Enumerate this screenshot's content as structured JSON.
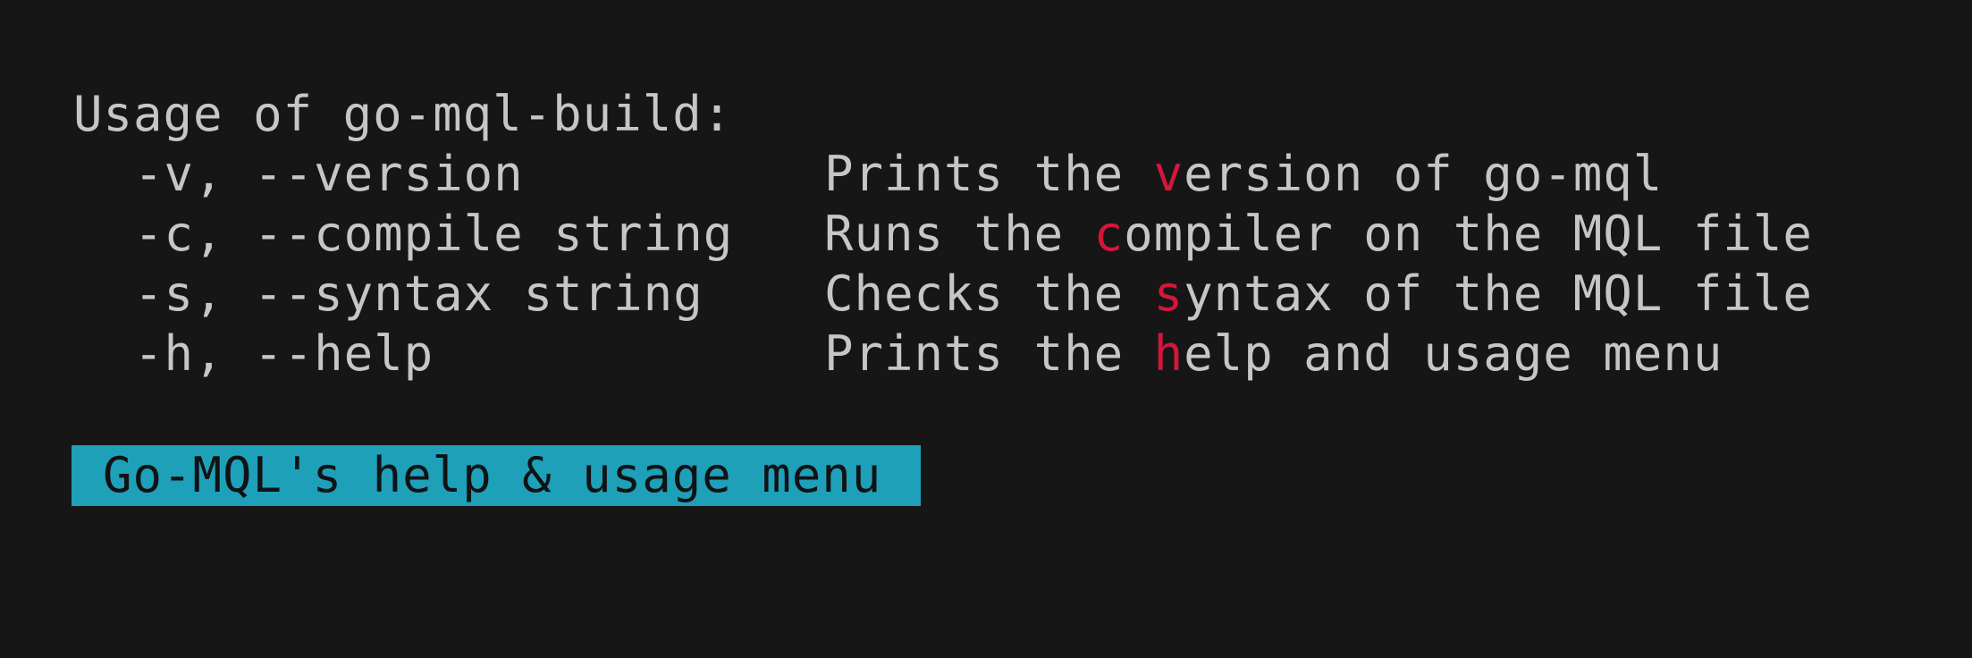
{
  "terminal": {
    "background": "#161617",
    "text_color": "#c6c6c6",
    "accent_color": "#d5163b",
    "usage_title": "Usage of go-mql-build:",
    "options": [
      {
        "flag": "-v, --version",
        "desc_prefix": "Prints the ",
        "desc_hl": "v",
        "desc_suffix": "ersion of go-mql"
      },
      {
        "flag": "-c, --compile string",
        "desc_prefix": "Runs the ",
        "desc_hl": "c",
        "desc_suffix": "ompiler on the MQL file"
      },
      {
        "flag": "-s, --syntax string",
        "desc_prefix": "Checks the ",
        "desc_hl": "s",
        "desc_suffix": "yntax of the MQL file"
      },
      {
        "flag": "-h, --help",
        "desc_prefix": "Prints the ",
        "desc_hl": "h",
        "desc_suffix": "elp and usage menu"
      }
    ]
  },
  "banner": {
    "text": "Go-MQL's help & usage menu",
    "background": "#1ea0b9",
    "text_color": "#111214"
  }
}
